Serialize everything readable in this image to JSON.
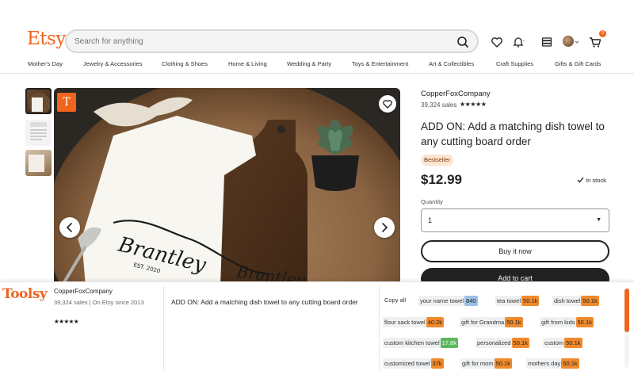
{
  "header": {
    "logo": "Etsy",
    "search_placeholder": "Search for anything",
    "cart_count": "0"
  },
  "categories": [
    "Mother's Day",
    "Jewelry & Accessories",
    "Clothing & Shoes",
    "Home & Living",
    "Wedding & Party",
    "Toys & Entertainment",
    "Art & Collectibles",
    "Craft Supplies",
    "Gifts & Gift Cards"
  ],
  "gallery": {
    "shop_badge": "T"
  },
  "listing": {
    "shop_name": "CopperFoxCompany",
    "sales": "39,324 sales",
    "stars": "★★★★★",
    "title": "ADD ON: Add a matching dish towel to any cutting board order",
    "badge": "Bestseller",
    "price": "$12.99",
    "stock": "In stock",
    "quantity_label": "Quantity",
    "quantity_value": "1",
    "buy_label": "Buy it now",
    "cart_label": "Add to cart"
  },
  "toolsy": {
    "logo": "Toolsy",
    "shop_name": "CopperFoxCompany",
    "sales": "39,324 sales | On Etsy since 2013",
    "stars": "★★★★★",
    "title": "ADD ON: Add a matching dish towel to any cutting board order",
    "copy_all": "Copy all",
    "tags": [
      {
        "label": "your name towel",
        "count": "840",
        "color": "blue"
      },
      {
        "label": "tea towel",
        "count": "50.1k",
        "color": "orange"
      },
      {
        "label": "dish towel",
        "count": "50.1k",
        "color": "orange"
      },
      {
        "label": "flour sack towel",
        "count": "40.2k",
        "color": "orange"
      },
      {
        "label": "gift for Grandma",
        "count": "50.1k",
        "color": "orange"
      },
      {
        "label": "gift from kids",
        "count": "50.1k",
        "color": "orange"
      },
      {
        "label": "custom kitchen towel",
        "count": "17.8k",
        "color": "green"
      },
      {
        "label": "personalized",
        "count": "50.1k",
        "color": "orange"
      },
      {
        "label": "custom",
        "count": "50.1k",
        "color": "orange"
      },
      {
        "label": "customized towel",
        "count": "37k",
        "color": "orange"
      },
      {
        "label": "gift for mom",
        "count": "50.1k",
        "color": "orange"
      },
      {
        "label": "mothers day",
        "count": "50.1k",
        "color": "orange"
      }
    ]
  },
  "colors": {
    "brand": "#f1641e",
    "dark": "#222222"
  }
}
